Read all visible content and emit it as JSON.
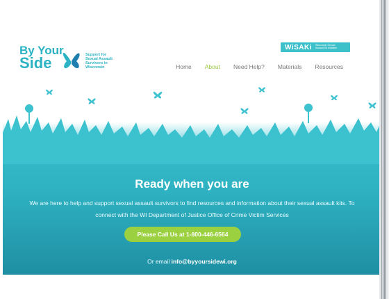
{
  "header": {
    "logo": {
      "line1": "By Your",
      "line2": "Side",
      "tagline": [
        "Support for",
        "Sexual Assault",
        "Survivors in",
        "Wisconsin"
      ]
    },
    "partner_badge": {
      "name": "WiSAKi",
      "subtitle": [
        "Wisconsin Sexual",
        "Assault Kit Initiative"
      ]
    },
    "nav": [
      {
        "label": "Home",
        "active": false
      },
      {
        "label": "About",
        "active": true
      },
      {
        "label": "Need Help?",
        "active": false
      },
      {
        "label": "Materials",
        "active": false
      },
      {
        "label": "Resources",
        "active": false
      }
    ]
  },
  "hero": {
    "headline": "Ready when you are",
    "body": "We are here to help and support sexual assault survivors to find resources and information about their sexual assault kits. To connect with the WI Department of Justice Office of Crime Victim Services",
    "cta_label": "Please Call Us at 1-800-446-6564",
    "email_prefix": "Or email",
    "email": "info@byyoursidewi.org"
  },
  "colors": {
    "teal": "#3cc2cf",
    "green": "#9bd140",
    "nav_active": "#9bc53d"
  },
  "icons": [
    "butterfly-icon",
    "flower-icon"
  ]
}
